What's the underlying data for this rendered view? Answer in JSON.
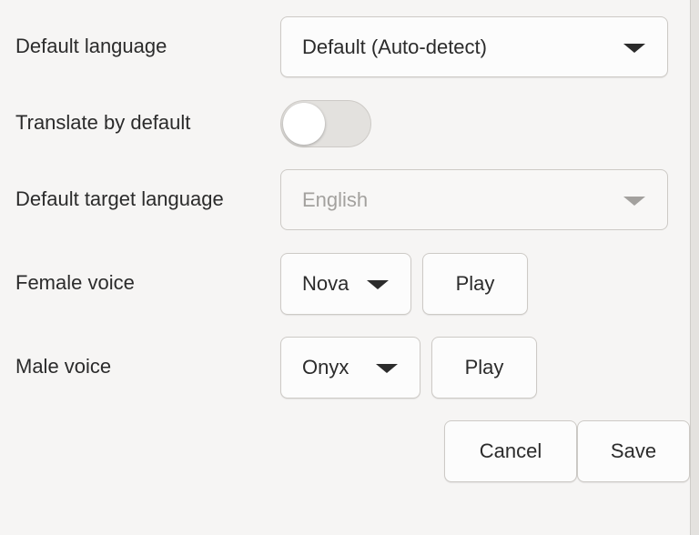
{
  "settings": {
    "default_language": {
      "label": "Default language",
      "value": "Default (Auto-detect)"
    },
    "translate_by_default": {
      "label": "Translate by default",
      "enabled": false
    },
    "default_target_language": {
      "label": "Default target language",
      "value": "English",
      "disabled": true
    },
    "female_voice": {
      "label": "Female voice",
      "value": "Nova",
      "play_label": "Play"
    },
    "male_voice": {
      "label": "Male voice",
      "value": "Onyx",
      "play_label": "Play"
    }
  },
  "actions": {
    "cancel_label": "Cancel",
    "save_label": "Save"
  },
  "icons": {
    "dropdown": "chevron-down-icon",
    "toggle": "toggle-switch"
  }
}
